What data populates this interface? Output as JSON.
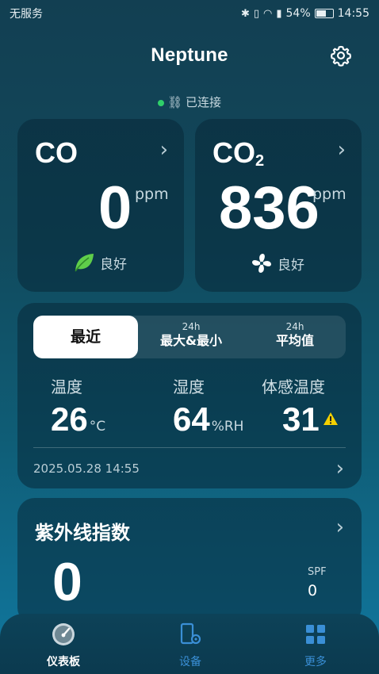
{
  "status_bar": {
    "carrier": "无服务",
    "battery": "54%",
    "time": "14:55"
  },
  "header": {
    "title": "Neptune",
    "connection": "已连接"
  },
  "co_card": {
    "name": "CO",
    "value": "0",
    "unit": "ppm",
    "quality": "良好"
  },
  "co2_card": {
    "name_main": "CO",
    "name_sub": "2",
    "value": "836",
    "unit": "ppm",
    "quality": "良好"
  },
  "climate_card": {
    "tabs": {
      "recent": "最近",
      "max_min_small": "24h",
      "max_min": "最大&最小",
      "avg_small": "24h",
      "avg": "平均值"
    },
    "temperature": {
      "label": "温度",
      "value": "26",
      "unit": "°C"
    },
    "humidity": {
      "label": "湿度",
      "value": "64",
      "unit": "%RH"
    },
    "feels_like": {
      "label": "体感温度",
      "value": "31"
    },
    "timestamp": "2025.05.28 14:55"
  },
  "uv_card": {
    "title": "紫外线指数",
    "value": "0",
    "spf_label": "SPF",
    "spf_value": "0"
  },
  "nav": {
    "dashboard": "仪表板",
    "devices": "设备",
    "more": "更多"
  },
  "colors": {
    "accent_blue": "#3a8fd6",
    "connected_green": "#2fd06a",
    "warning_yellow": "#f5d000"
  }
}
